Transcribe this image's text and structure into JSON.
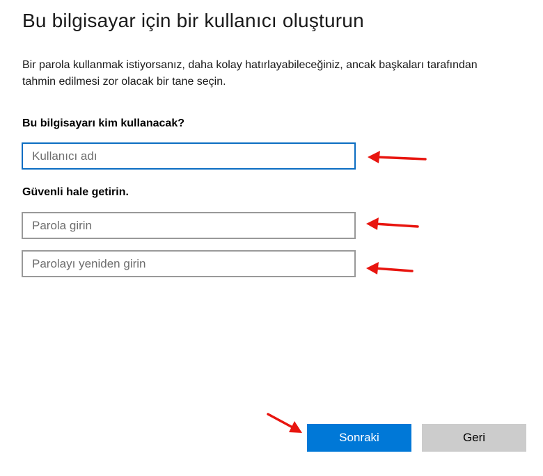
{
  "page": {
    "title": "Bu bilgisayar için bir kullanıcı oluşturun",
    "description": "Bir parola kullanmak istiyorsanız, daha kolay hatırlayabileceğiniz, ancak başkaları tarafından tahmin edilmesi zor olacak bir tane seçin."
  },
  "user_section": {
    "label": "Bu bilgisayarı kim kullanacak?",
    "username_placeholder": "Kullanıcı adı",
    "username_value": ""
  },
  "security_section": {
    "label": "Güvenli hale getirin.",
    "password_placeholder": "Parola girin",
    "password_value": "",
    "confirm_placeholder": "Parolayı yeniden girin",
    "confirm_value": ""
  },
  "buttons": {
    "next_label": "Sonraki",
    "back_label": "Geri"
  },
  "colors": {
    "accent": "#0078d7",
    "focus_border": "#0b6dc2",
    "annotation_arrow": "#e8150f"
  },
  "icons": {
    "annotation": "red-arrow-icon"
  }
}
